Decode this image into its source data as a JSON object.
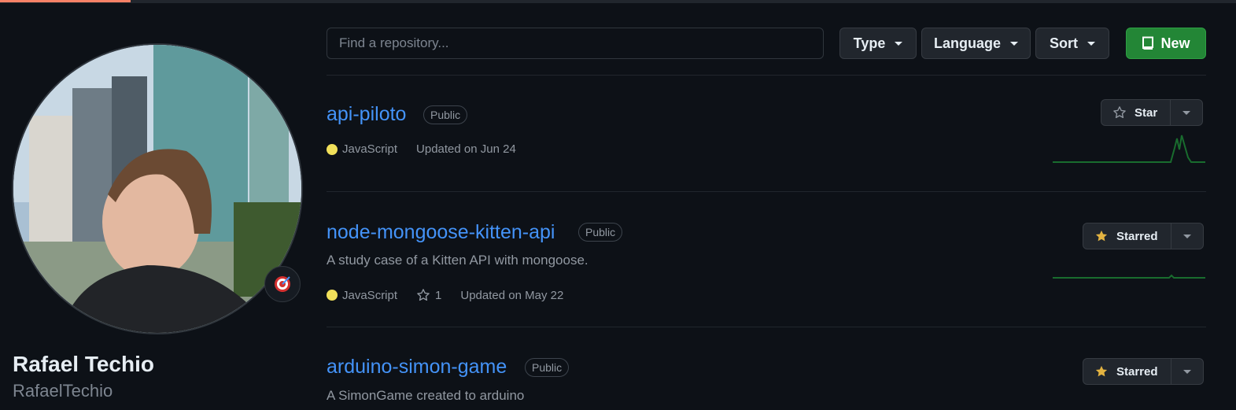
{
  "profile": {
    "name": "Rafael Techio",
    "login": "RafaelTechio",
    "status_icon": "target-icon"
  },
  "toolbar": {
    "search_placeholder": "Find a repository...",
    "type_label": "Type",
    "language_label": "Language",
    "sort_label": "Sort",
    "new_label": "New"
  },
  "repos": [
    {
      "name": "api-piloto",
      "visibility": "Public",
      "description": "",
      "language": "JavaScript",
      "language_color": "#f1e05a",
      "stars": "",
      "updated": "Updated on Jun 24",
      "star_label": "Star",
      "starred": false
    },
    {
      "name": "node-mongoose-kitten-api",
      "visibility": "Public",
      "description": "A study case of a Kitten API with mongoose.",
      "language": "JavaScript",
      "language_color": "#f1e05a",
      "stars": "1",
      "updated": "Updated on May 22",
      "star_label": "Starred",
      "starred": true
    },
    {
      "name": "arduino-simon-game",
      "visibility": "Public",
      "description": "A SimonGame created to arduino",
      "language": "",
      "stars": "",
      "updated": "",
      "star_label": "Starred",
      "starred": true
    }
  ],
  "colors": {
    "accent_link": "#4493f8",
    "primary_button": "#238636",
    "starred_icon": "#e3b341",
    "sparkline": "#196c2e"
  }
}
